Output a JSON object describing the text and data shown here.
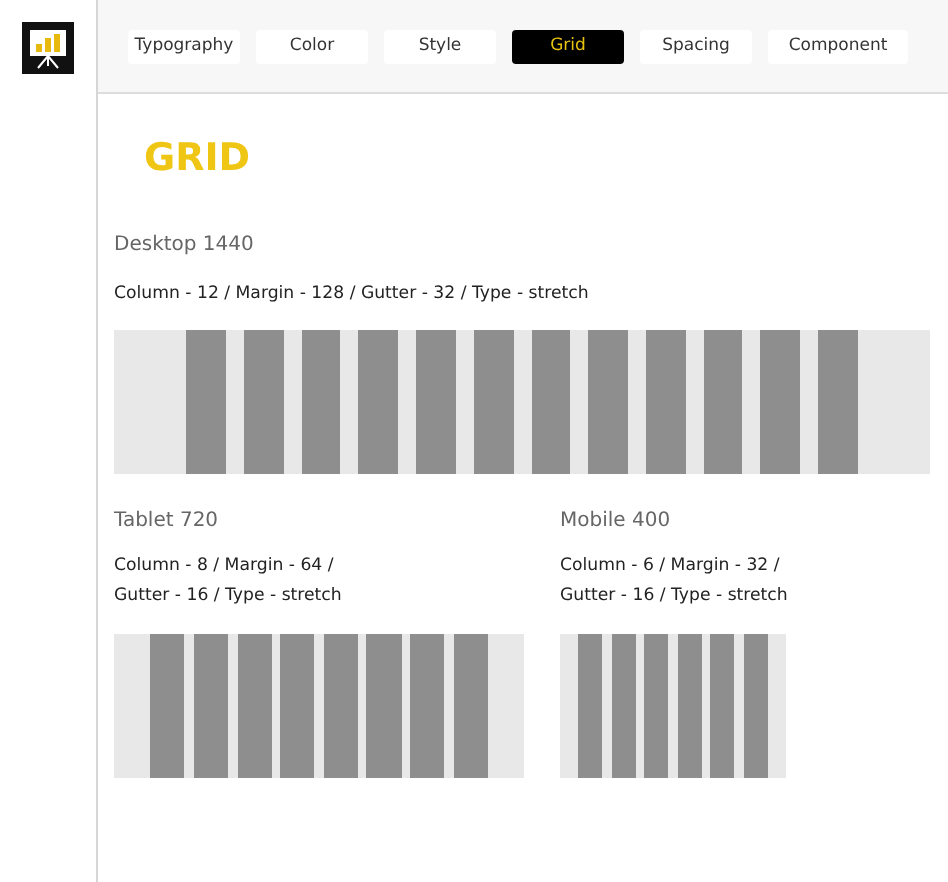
{
  "tabs": [
    {
      "label": "Typography",
      "selected": false
    },
    {
      "label": "Color",
      "selected": false
    },
    {
      "label": "Style",
      "selected": false
    },
    {
      "label": "Grid",
      "selected": true
    },
    {
      "label": "Spacing",
      "selected": false
    },
    {
      "label": "Component",
      "selected": false
    }
  ],
  "heading": "GRID",
  "layouts": [
    {
      "kind": "wide",
      "title": "Desktop 1440",
      "spec": "Column - 12 / Margin - 128 / Gutter - 32 /  Type - stretch"
    },
    {
      "kind": "narrow",
      "title": "Tablet 720",
      "spec": "Column - 8 / Margin - 64 / Gutter - 16 /  Type - stretch"
    },
    {
      "kind": "small",
      "title": "Mobile 400",
      "spec": "Column - 6 / Margin - 32 /  Gutter - 16 /  Type - stretch"
    }
  ]
}
